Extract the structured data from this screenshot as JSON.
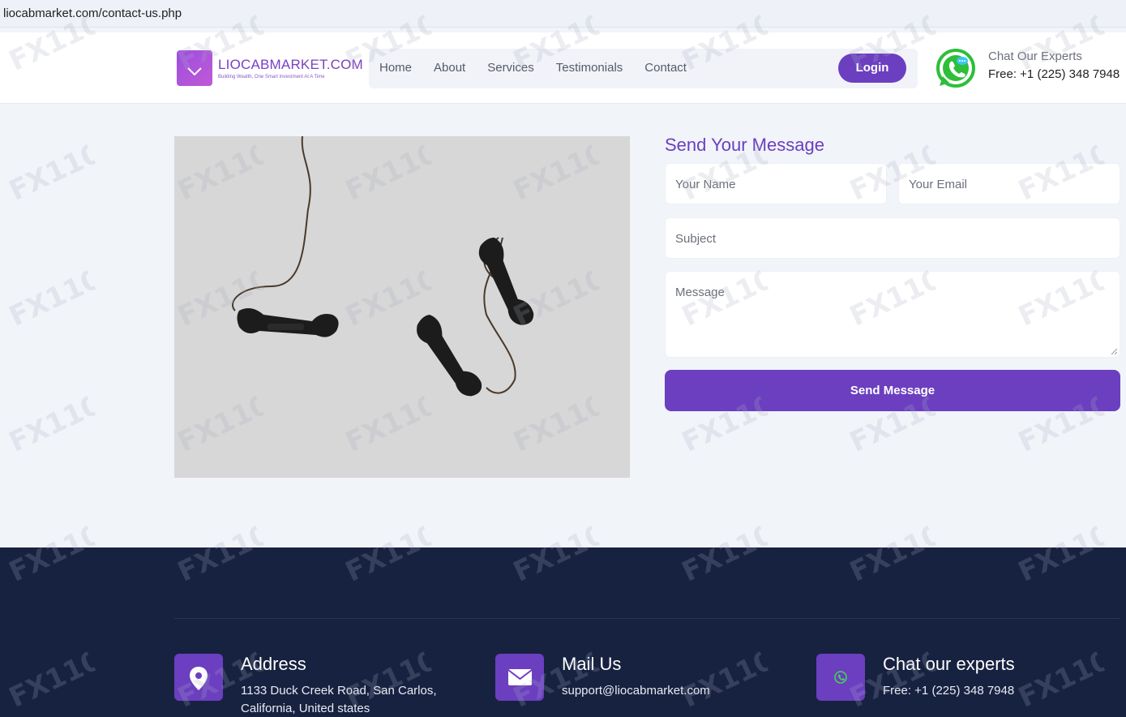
{
  "browser": {
    "url": "liocabmarket.com/contact-us.php"
  },
  "header": {
    "brand_name": "LIOCABMARKET.COM",
    "brand_tagline": "Building Wealth, One Smart Investment At A Time",
    "nav": [
      "Home",
      "About",
      "Services",
      "Testimonials",
      "Contact"
    ],
    "login_label": "Login",
    "chat_label": "Chat Our Experts",
    "chat_phone": "Free: +1 (225) 348 7948"
  },
  "contact_form": {
    "title": "Send Your Message",
    "name_placeholder": "Your Name",
    "email_placeholder": "Your Email",
    "subject_placeholder": "Subject",
    "message_placeholder": "Message",
    "submit_label": "Send Message"
  },
  "footer": {
    "address_title": "Address",
    "address_line1": "1133 Duck Creek Road, San Carlos,",
    "address_line2": "California, United states",
    "mail_title": "Mail Us",
    "mail_value": "support@liocabmarket.com",
    "chat_title": "Chat our experts",
    "chat_value": "Free: +1 (225) 348 7948"
  },
  "colors": {
    "accent": "#6b3fc0",
    "footer_bg": "#172240",
    "page_bg": "#f1f4f9",
    "whatsapp": "#2fbe3a"
  },
  "icons": [
    "whatsapp-icon",
    "location-pin-icon",
    "mail-icon",
    "whatsapp-small-icon"
  ]
}
